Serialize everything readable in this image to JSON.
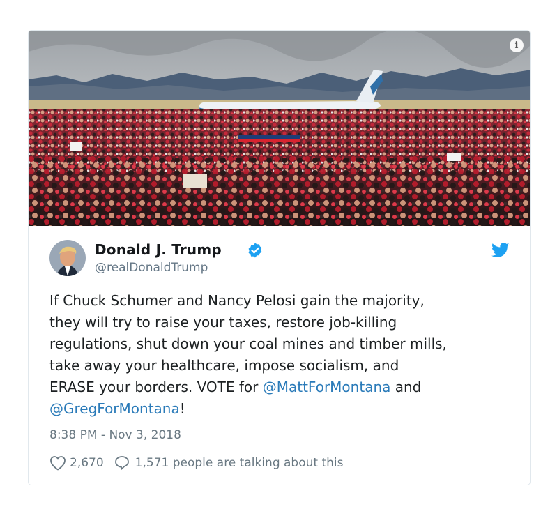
{
  "media": {
    "description_icon": "info-icon"
  },
  "author": {
    "name": "Donald J. Trump",
    "handle": "@realDonaldTrump",
    "verified_icon": "verified-badge-icon",
    "platform_icon": "twitter-bird-icon"
  },
  "tweet": {
    "text_before": "If Chuck Schumer and Nancy Pelosi gain the majority,\nthey will try to raise your taxes, restore job-killing\nregulations, shut down your coal mines and timber mills,\ntake away your healthcare, impose socialism, and\nERASE your borders. VOTE for ",
    "mention_1": "@MattForMontana",
    "text_between": " and\n",
    "mention_2": "@GregForMontana",
    "text_after": "!",
    "timestamp": "8:38 PM - Nov 3, 2018"
  },
  "actions": {
    "like_count": "2,670",
    "talking_text": "1,571 people are talking about this"
  },
  "colors": {
    "link": "#2b7bb9",
    "verified": "#1da1f2",
    "twitter_blue": "#1da1f2",
    "meta_gray": "#697882"
  }
}
